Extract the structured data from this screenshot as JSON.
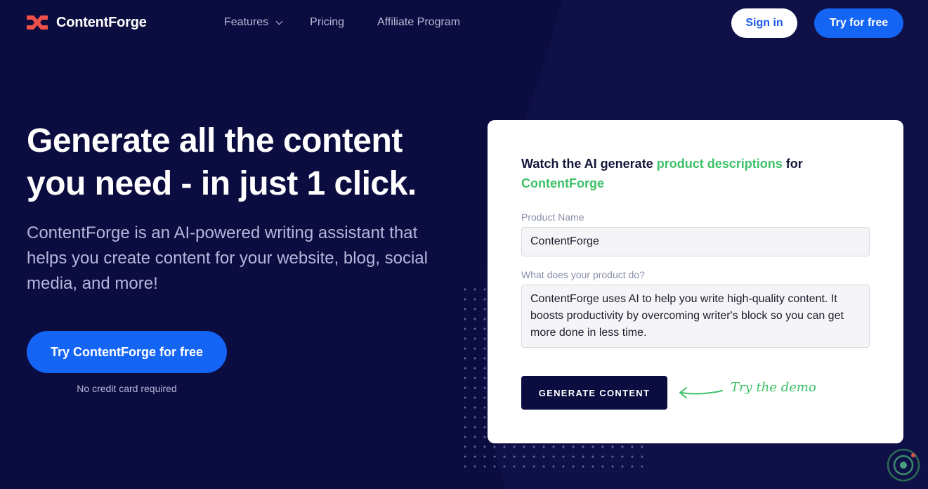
{
  "brand": {
    "name": "ContentForge",
    "accent_color": "#1565f5",
    "logo_color": "#f0504a",
    "green": "#3cc168",
    "background": "#0b0c3f"
  },
  "nav": {
    "links": [
      "Features",
      "Pricing",
      "Affiliate Program"
    ],
    "sign_in": "Sign in",
    "try_free": "Try for free"
  },
  "hero": {
    "title": "Generate all the content you need - in just 1 click.",
    "subtitle": "ContentForge is an AI-powered writing assistant that helps you create content for your website, blog, social media, and more!",
    "cta": "Try ContentForge for free",
    "note": "No credit card required"
  },
  "demo": {
    "heading_prefix": "Watch the AI generate ",
    "heading_highlight": "product descriptions",
    "heading_middle": " for ",
    "heading_product": "ContentForge",
    "product_name_label": "Product Name",
    "product_name_value": "ContentForge",
    "product_desc_label": "What does your product do?",
    "product_desc_value": "ContentForge uses AI to help you write high-quality content. It boosts productivity by overcoming writer's block so you can get more done in less time.",
    "generate_button": "GENERATE CONTENT",
    "hint": "Try the demo"
  }
}
